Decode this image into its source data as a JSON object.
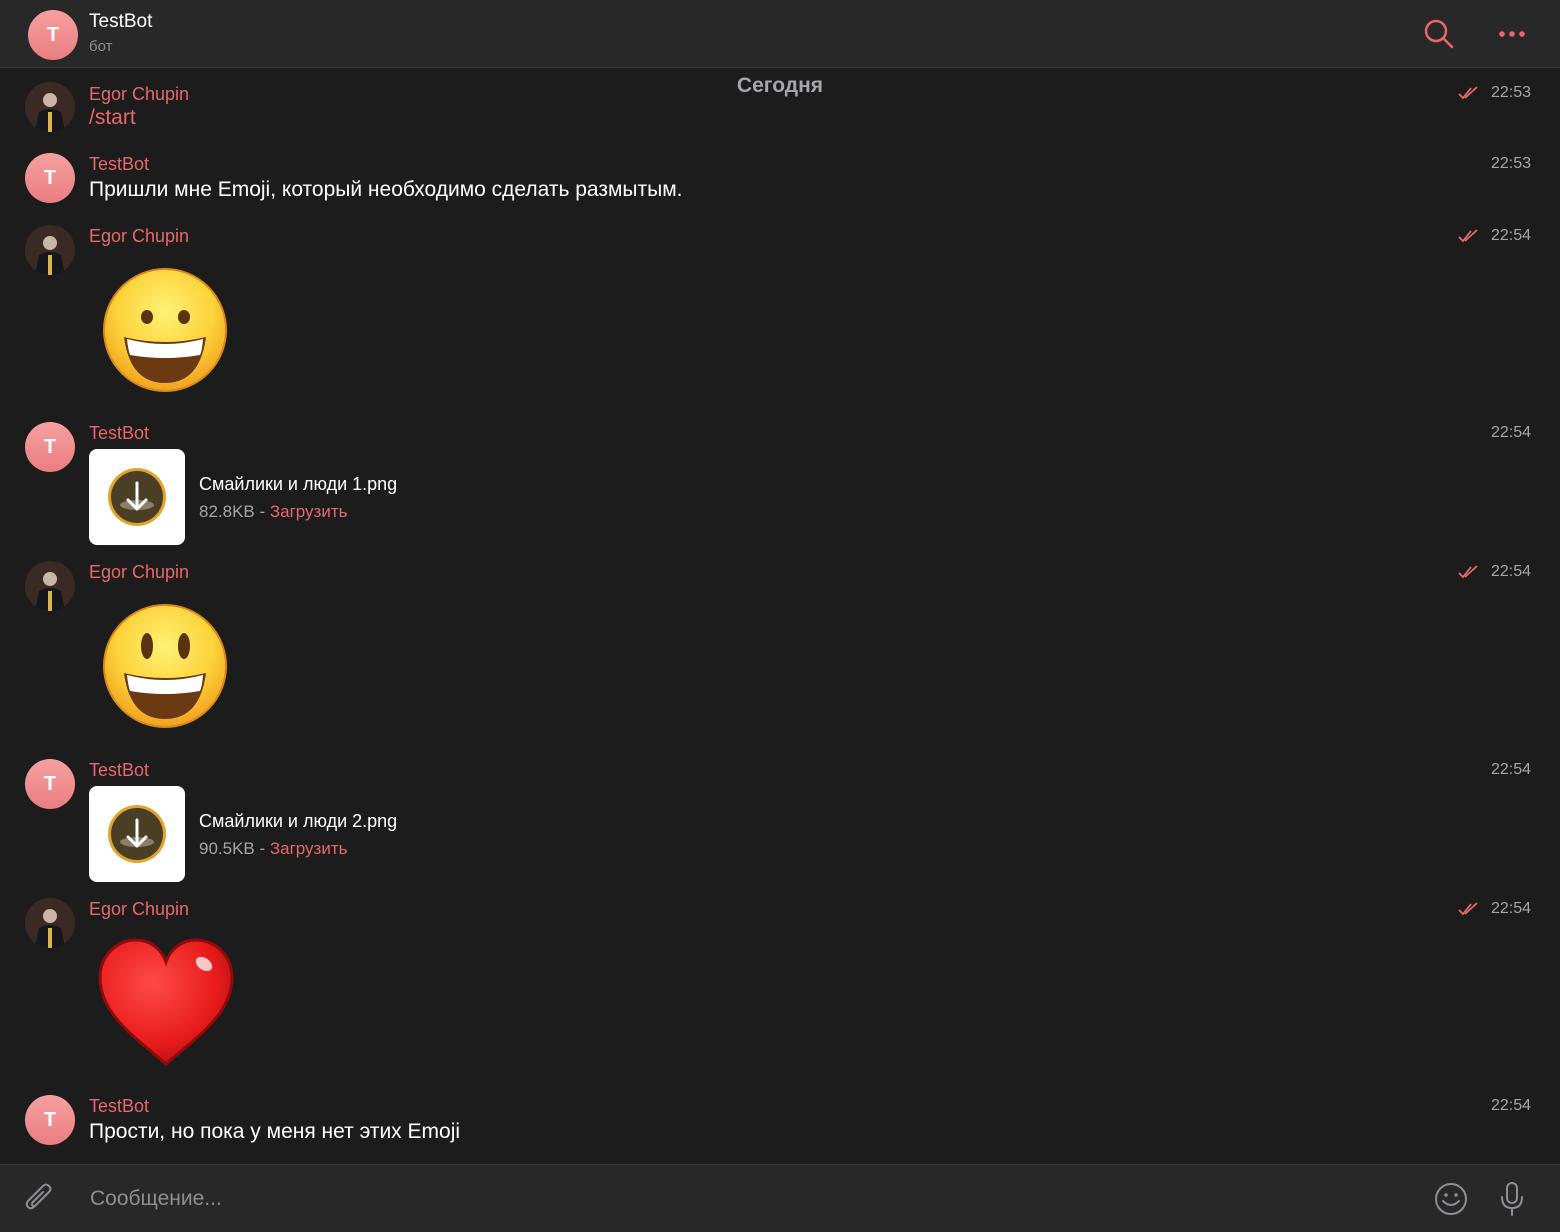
{
  "header": {
    "avatar_letter": "T",
    "title": "TestBot",
    "subtitle": "бот",
    "search_icon": "search-icon",
    "more_icon": "more-icon"
  },
  "date_divider": "Сегодня",
  "colors": {
    "accent": "#e8676b",
    "background": "#1c1c1d",
    "panel": "#282829",
    "muted": "#a5a5aa",
    "heart": "#e81b1b"
  },
  "messages": [
    {
      "sender": "Egor Chupin",
      "time": "22:53",
      "type": "text",
      "text": "/start",
      "read": true
    },
    {
      "sender": "TestBot",
      "avatar_letter": "T",
      "time": "22:53",
      "type": "text",
      "text": "Пришли мне Emoji, который необходимо сделать размытым."
    },
    {
      "sender": "Egor Chupin",
      "time": "22:54",
      "type": "emoji",
      "emoji": "grinning-face",
      "read": true
    },
    {
      "sender": "TestBot",
      "avatar_letter": "T",
      "time": "22:54",
      "type": "file",
      "file_name": "Смайлики и люди 1.png",
      "file_size": "82.8KB",
      "separator": " - ",
      "download_label": "Загрузить"
    },
    {
      "sender": "Egor Chupin",
      "time": "22:54",
      "type": "emoji",
      "emoji": "smiling-face-big-eyes",
      "read": true
    },
    {
      "sender": "TestBot",
      "avatar_letter": "T",
      "time": "22:54",
      "type": "file",
      "file_name": "Смайлики и люди 2.png",
      "file_size": "90.5KB",
      "separator": " - ",
      "download_label": "Загрузить"
    },
    {
      "sender": "Egor Chupin",
      "time": "22:54",
      "type": "emoji",
      "emoji": "red-heart",
      "read": true
    },
    {
      "sender": "TestBot",
      "avatar_letter": "T",
      "time": "22:54",
      "type": "text",
      "text": "Прости, но пока у меня нет этих Emoji"
    }
  ],
  "composer": {
    "placeholder": "Сообщение...",
    "attach_icon": "paperclip-icon",
    "emoji_icon": "smiley-icon",
    "mic_icon": "microphone-icon"
  }
}
